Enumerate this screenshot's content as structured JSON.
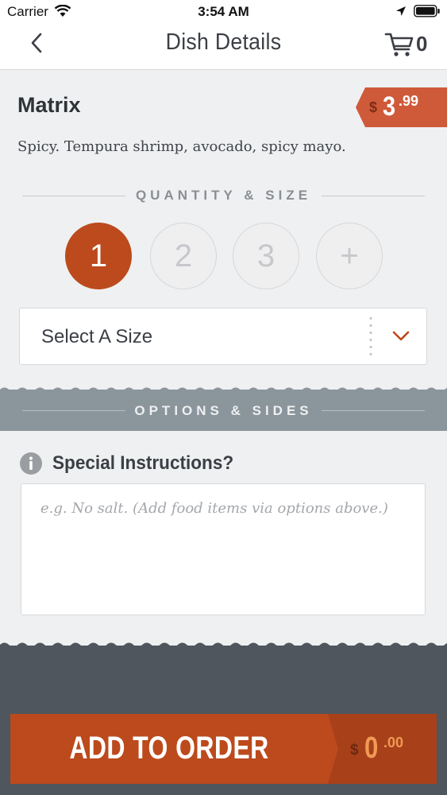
{
  "status_bar": {
    "carrier": "Carrier",
    "time": "3:54 AM"
  },
  "nav": {
    "title": "Dish Details",
    "cart_count": "0"
  },
  "dish": {
    "name": "Matrix",
    "description": "Spicy. Tempura shrimp, avocado, spicy mayo.",
    "price": {
      "currency": "$",
      "main": "3",
      "cents": ".99"
    }
  },
  "quantity_section": {
    "heading": "QUANTITY & SIZE",
    "options": [
      "1",
      "2",
      "3",
      "+"
    ],
    "selected": "1",
    "size_select_label": "Select A Size"
  },
  "options_section": {
    "heading": "OPTIONS & SIDES"
  },
  "special_instructions": {
    "label": "Special Instructions?",
    "placeholder": "e.g. No salt. (Add food items via options above.)",
    "value": ""
  },
  "footer": {
    "add_label": "ADD TO ORDER",
    "total": {
      "currency": "$",
      "main": "0",
      "cents": ".00"
    }
  },
  "colors": {
    "accent": "#bc4a1c",
    "price_tag": "#cf5a3a",
    "options_band": "#8b959c",
    "footer": "#4f565d"
  },
  "icons": [
    "wifi-icon",
    "location-icon",
    "battery-icon",
    "back-icon",
    "cart-icon",
    "chevron-down-icon",
    "info-icon"
  ]
}
